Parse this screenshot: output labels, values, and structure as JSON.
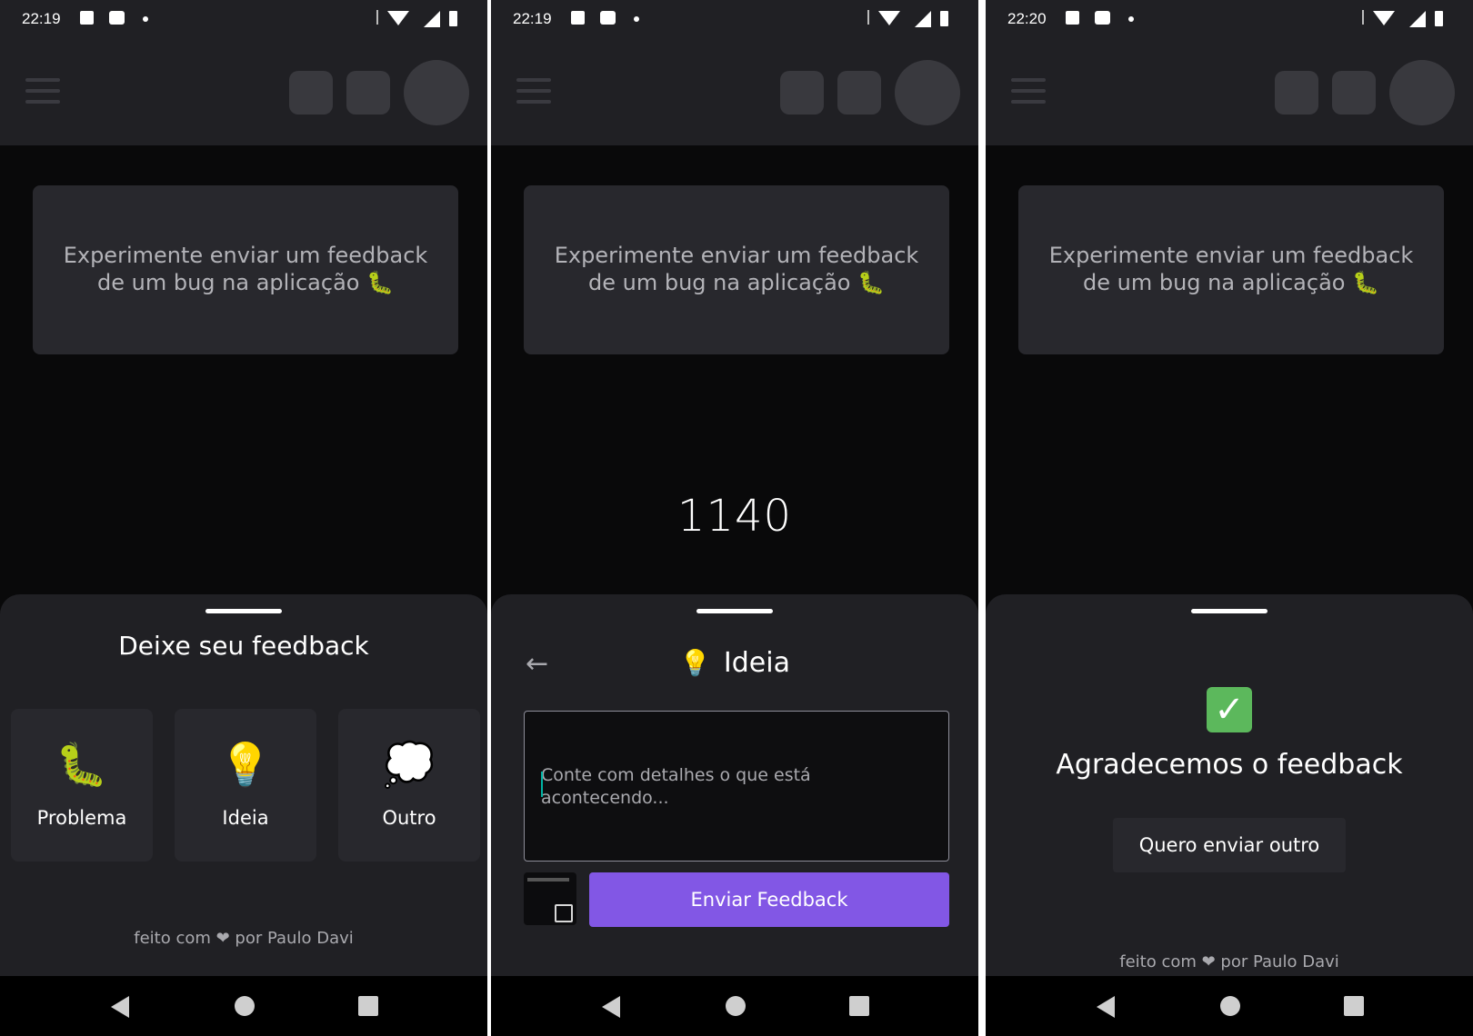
{
  "screens": [
    {
      "status_time": "22:19",
      "card_text_line1": "Experimente enviar um feedback",
      "card_text_line2": "de um bug na aplicação 🐛",
      "sheet": {
        "title": "Deixe seu feedback",
        "types": [
          {
            "icon": "🐛",
            "icon_name": "bug-icon",
            "label": "Problema"
          },
          {
            "icon": "💡",
            "icon_name": "lightbulb-icon",
            "label": "Ideia"
          },
          {
            "icon": "💭",
            "icon_name": "thought-bubble-icon",
            "label": "Outro"
          }
        ],
        "footer": "feito com ❤ por Paulo Davi"
      }
    },
    {
      "status_time": "22:19",
      "card_text_line1": "Experimente enviar um feedback",
      "card_text_line2": "de um bug na aplicação 🐛",
      "big_number": "1140",
      "sheet": {
        "back_icon": "←",
        "title_icon": "💡",
        "title": "Ideia",
        "textarea_placeholder": "Conte com detalhes o que está acontecendo...",
        "submit_label": "Enviar Feedback"
      }
    },
    {
      "status_time": "22:20",
      "card_text_line1": "Experimente enviar um feedback",
      "card_text_line2": "de um bug na aplicação 🐛",
      "sheet": {
        "success_icon": "✓",
        "title": "Agradecemos o feedback",
        "button_label": "Quero enviar outro",
        "footer": "feito com ❤ por Paulo Davi"
      }
    }
  ],
  "colors": {
    "background": "#09090a",
    "surface": "#202024",
    "card": "#28282d",
    "brand": "#8257e5",
    "success": "#5cb85c"
  }
}
